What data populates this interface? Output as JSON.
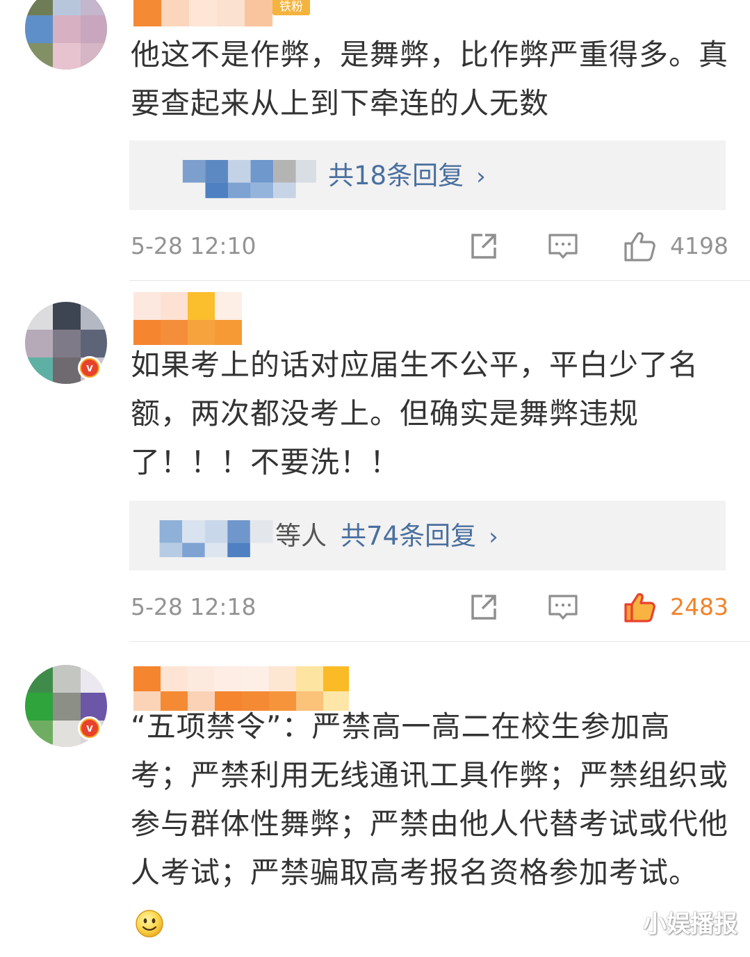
{
  "comments": [
    {
      "fan_badge": "铁粉",
      "text": "他这不是作弊，是舞弊，比作弊严重得多。真要查起来从上到下牵连的人无数",
      "reply_summary": "共18条回复",
      "timestamp": "5-28 12:10",
      "like_count": "4198",
      "liked": false
    },
    {
      "text": "如果考上的话对应届生不公平，平白少了名额，两次都没考上。但确实是舞弊违规了！！！不要洗！！",
      "reply_prefix": "等人",
      "reply_summary": "共74条回复",
      "timestamp": "5-28 12:18",
      "like_count": "2483",
      "liked": true
    },
    {
      "text": "“五项禁令”：严禁高一高二在校生参加高考；严禁利用无线通讯工具作弊；严禁组织或参与群体性舞弊；严禁由他人代替考试或代他人考试；严禁骗取高考报名资格参加考试。"
    }
  ],
  "watermark": "小娱播报",
  "icons": {
    "share": "share-icon",
    "comment": "comment-icon",
    "like": "thumbs-up-icon",
    "verified": "verified-v-icon",
    "chevron": "chevron-right-icon",
    "smiley": "smiley-emoji-icon"
  },
  "colors": {
    "link": "#4a6f9f",
    "liked": "#f0832b",
    "meta": "#939393",
    "fan_badge": "#f3b33d"
  }
}
